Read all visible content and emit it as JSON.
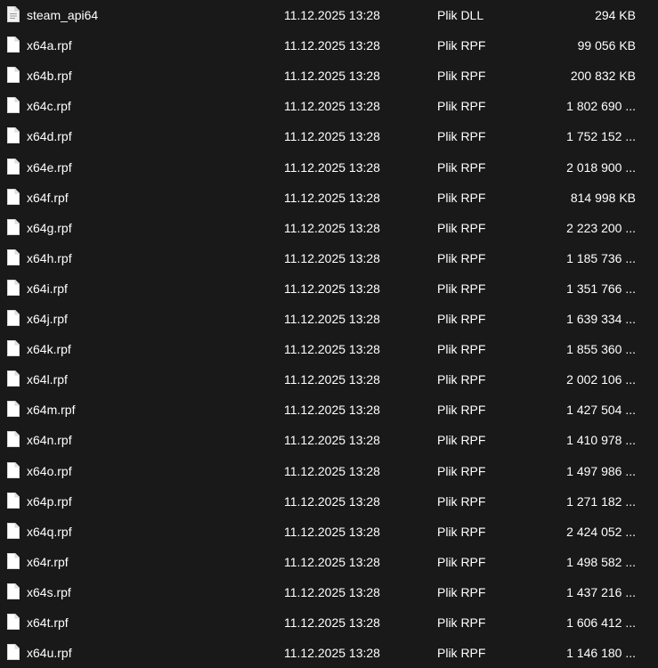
{
  "files": [
    {
      "name": "steam_api64",
      "date": "11.12.2025 13:28",
      "type": "Plik DLL",
      "size": "294 KB",
      "icon": "dll-file-icon"
    },
    {
      "name": "x64a.rpf",
      "date": "11.12.2025 13:28",
      "type": "Plik RPF",
      "size": "99 056 KB",
      "icon": "file-icon"
    },
    {
      "name": "x64b.rpf",
      "date": "11.12.2025 13:28",
      "type": "Plik RPF",
      "size": "200 832 KB",
      "icon": "file-icon"
    },
    {
      "name": "x64c.rpf",
      "date": "11.12.2025 13:28",
      "type": "Plik RPF",
      "size": "1 802 690 ...",
      "icon": "file-icon"
    },
    {
      "name": "x64d.rpf",
      "date": "11.12.2025 13:28",
      "type": "Plik RPF",
      "size": "1 752 152 ...",
      "icon": "file-icon"
    },
    {
      "name": "x64e.rpf",
      "date": "11.12.2025 13:28",
      "type": "Plik RPF",
      "size": "2 018 900 ...",
      "icon": "file-icon"
    },
    {
      "name": "x64f.rpf",
      "date": "11.12.2025 13:28",
      "type": "Plik RPF",
      "size": "814 998 KB",
      "icon": "file-icon"
    },
    {
      "name": "x64g.rpf",
      "date": "11.12.2025 13:28",
      "type": "Plik RPF",
      "size": "2 223 200 ...",
      "icon": "file-icon"
    },
    {
      "name": "x64h.rpf",
      "date": "11.12.2025 13:28",
      "type": "Plik RPF",
      "size": "1 185 736 ...",
      "icon": "file-icon"
    },
    {
      "name": "x64i.rpf",
      "date": "11.12.2025 13:28",
      "type": "Plik RPF",
      "size": "1 351 766 ...",
      "icon": "file-icon"
    },
    {
      "name": "x64j.rpf",
      "date": "11.12.2025 13:28",
      "type": "Plik RPF",
      "size": "1 639 334 ...",
      "icon": "file-icon"
    },
    {
      "name": "x64k.rpf",
      "date": "11.12.2025 13:28",
      "type": "Plik RPF",
      "size": "1 855 360 ...",
      "icon": "file-icon"
    },
    {
      "name": "x64l.rpf",
      "date": "11.12.2025 13:28",
      "type": "Plik RPF",
      "size": "2 002 106 ...",
      "icon": "file-icon"
    },
    {
      "name": "x64m.rpf",
      "date": "11.12.2025 13:28",
      "type": "Plik RPF",
      "size": "1 427 504 ...",
      "icon": "file-icon"
    },
    {
      "name": "x64n.rpf",
      "date": "11.12.2025 13:28",
      "type": "Plik RPF",
      "size": "1 410 978 ...",
      "icon": "file-icon"
    },
    {
      "name": "x64o.rpf",
      "date": "11.12.2025 13:28",
      "type": "Plik RPF",
      "size": "1 497 986 ...",
      "icon": "file-icon"
    },
    {
      "name": "x64p.rpf",
      "date": "11.12.2025 13:28",
      "type": "Plik RPF",
      "size": "1 271 182 ...",
      "icon": "file-icon"
    },
    {
      "name": "x64q.rpf",
      "date": "11.12.2025 13:28",
      "type": "Plik RPF",
      "size": "2 424 052 ...",
      "icon": "file-icon"
    },
    {
      "name": "x64r.rpf",
      "date": "11.12.2025 13:28",
      "type": "Plik RPF",
      "size": "1 498 582 ...",
      "icon": "file-icon"
    },
    {
      "name": "x64s.rpf",
      "date": "11.12.2025 13:28",
      "type": "Plik RPF",
      "size": "1 437 216 ...",
      "icon": "file-icon"
    },
    {
      "name": "x64t.rpf",
      "date": "11.12.2025 13:28",
      "type": "Plik RPF",
      "size": "1 606 412 ...",
      "icon": "file-icon"
    },
    {
      "name": "x64u.rpf",
      "date": "11.12.2025 13:28",
      "type": "Plik RPF",
      "size": "1 146 180 ...",
      "icon": "file-icon"
    }
  ],
  "colors": {
    "background": "#191919",
    "text": "#ffffff",
    "icon_fill": "#ffffff"
  }
}
